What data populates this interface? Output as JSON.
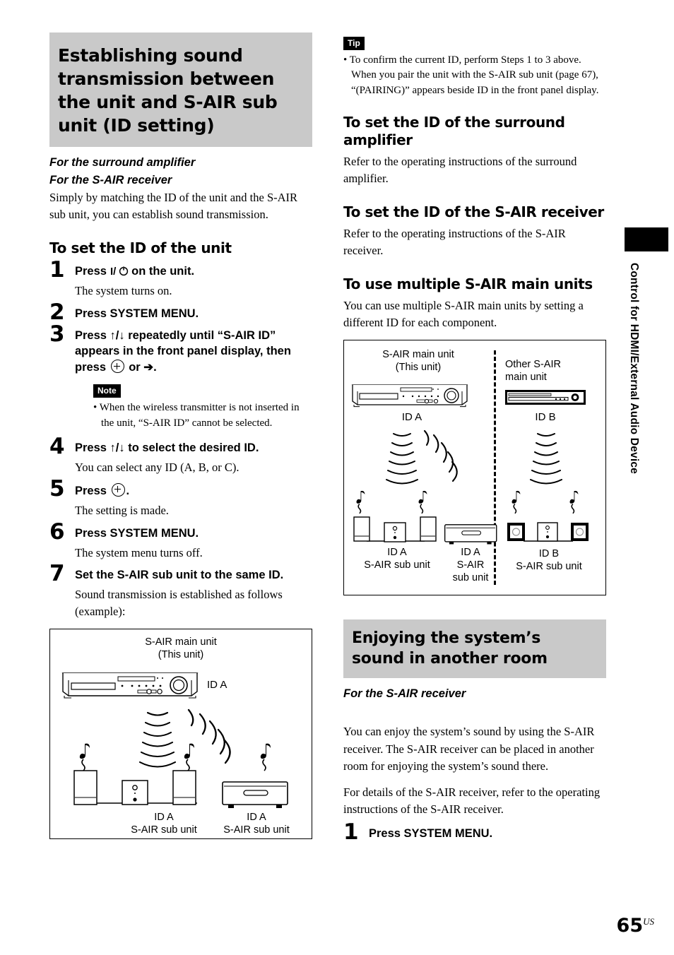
{
  "left": {
    "main_heading": "Establishing sound transmission between the unit and S-AIR sub unit (ID setting)",
    "subheads": [
      "For the surround amplifier",
      "For the S-AIR receiver"
    ],
    "intro": "Simply by matching the ID of the unit and the S-AIR sub unit, you can establish sound transmission.",
    "section_heading": "To set the ID of the unit",
    "steps": [
      {
        "num": "1",
        "title_pre": "Press ",
        "title_post": " on the unit.",
        "has_power": true,
        "desc": "The system turns on."
      },
      {
        "num": "2",
        "title": "Press SYSTEM MENU.",
        "desc": ""
      },
      {
        "num": "3",
        "title_a": "Press ↑/↓ repeatedly until “S-AIR ID” appears in the front panel display, then press ",
        "title_b": " or ➔.",
        "desc": ""
      },
      {
        "num": "4",
        "title": "Press ↑/↓ to select the desired ID.",
        "desc": "You can select any ID (A, B, or C)."
      },
      {
        "num": "5",
        "title_a": "Press ",
        "title_b": ".",
        "desc": "The setting is made."
      },
      {
        "num": "6",
        "title": "Press SYSTEM MENU.",
        "desc": "The system menu turns off."
      },
      {
        "num": "7",
        "title": "Set the S-AIR sub unit to the same ID.",
        "desc": "Sound transmission is established as follows (example):"
      }
    ],
    "note": {
      "badge": "Note",
      "items": [
        "When the wireless transmitter is not inserted in the unit, “S-AIR ID” cannot be selected."
      ]
    },
    "figure": {
      "main_unit_line1": "S-AIR main unit",
      "main_unit_line2": "(This unit)",
      "main_unit_id": "ID A",
      "sub1_id": "ID A",
      "sub1_name": "S-AIR sub unit",
      "sub2_id": "ID A",
      "sub2_name": "S-AIR sub unit"
    }
  },
  "right": {
    "tip": {
      "badge": "Tip",
      "items": [
        "To confirm the current ID, perform Steps 1 to 3 above. When you pair the unit with the S-AIR sub unit (page 67), “(PAIRING)” appears beside ID in the front panel display."
      ]
    },
    "sections": [
      {
        "heading": "To set the ID of the surround amplifier",
        "body": "Refer to the operating instructions of the surround amplifier."
      },
      {
        "heading": "To set the ID of the S-AIR receiver",
        "body": "Refer to the operating instructions of the S-AIR receiver."
      },
      {
        "heading": "To use multiple S-AIR main units",
        "body": "You can use multiple S-AIR main units by setting a different ID for each component."
      }
    ],
    "figure": {
      "left_unit_line1": "S-AIR main unit",
      "left_unit_line2": "(This unit)",
      "left_unit_id": "ID A",
      "right_unit_line1": "Other S-AIR",
      "right_unit_line2": "main unit",
      "right_unit_id": "ID B",
      "left_sub1_id": "ID A",
      "left_sub1_name": "S-AIR sub unit",
      "left_sub2_id": "ID A",
      "left_sub2_name_l1": "S-AIR",
      "left_sub2_name_l2": "sub unit",
      "right_sub_id": "ID B",
      "right_sub_name": "S-AIR sub unit"
    },
    "gray_heading": "Enjoying the system’s sound in another room",
    "gray_subhead": "For the S-AIR receiver",
    "para1": "You can enjoy the system’s sound by using the S-AIR receiver. The S-AIR receiver can be placed in another room for enjoying the system’s sound there.",
    "para2": "For details of the S-AIR receiver, refer to the operating instructions of the S-AIR receiver.",
    "step1": {
      "num": "1",
      "title": "Press SYSTEM MENU."
    }
  },
  "sidebar": {
    "label": "Control for HDMI/External Audio Device"
  },
  "folio": {
    "page": "65",
    "region": "US"
  },
  "colors": {
    "gray_head_bg": "#c9c9c9",
    "ink": "#000000",
    "paper": "#ffffff"
  }
}
